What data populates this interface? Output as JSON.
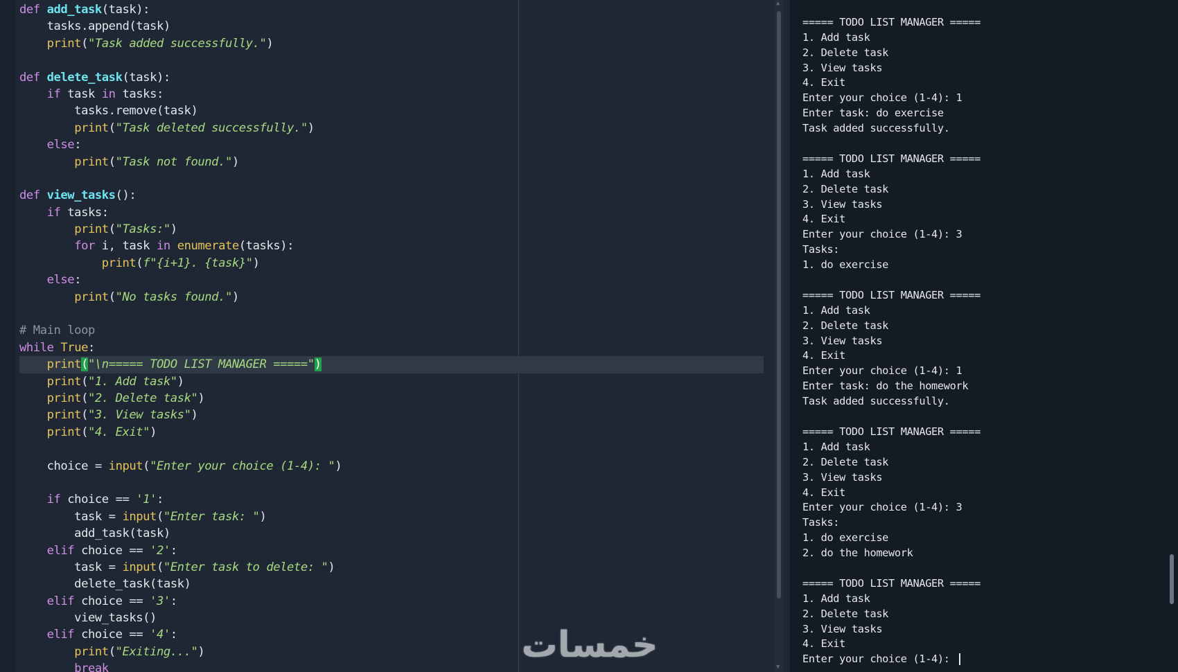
{
  "editor": {
    "lines": [
      [
        [
          "kw",
          "def "
        ],
        [
          "fn",
          "add_task"
        ],
        [
          "pu",
          "(task):"
        ]
      ],
      [
        [
          "pu",
          "    tasks.append(task)"
        ]
      ],
      [
        [
          "pu",
          "    "
        ],
        [
          "bi",
          "print"
        ],
        [
          "pu",
          "("
        ],
        [
          "st",
          "\"Task added successfully.\""
        ],
        [
          "pu",
          ")"
        ]
      ],
      [],
      [
        [
          "kw",
          "def "
        ],
        [
          "fn",
          "delete_task"
        ],
        [
          "pu",
          "(task):"
        ]
      ],
      [
        [
          "pu",
          "    "
        ],
        [
          "kw",
          "if"
        ],
        [
          "pu",
          " task "
        ],
        [
          "kw",
          "in"
        ],
        [
          "pu",
          " tasks:"
        ]
      ],
      [
        [
          "pu",
          "        tasks.remove(task)"
        ]
      ],
      [
        [
          "pu",
          "        "
        ],
        [
          "bi",
          "print"
        ],
        [
          "pu",
          "("
        ],
        [
          "st",
          "\"Task deleted successfully.\""
        ],
        [
          "pu",
          ")"
        ]
      ],
      [
        [
          "pu",
          "    "
        ],
        [
          "kw",
          "else"
        ],
        [
          "pu",
          ":"
        ]
      ],
      [
        [
          "pu",
          "        "
        ],
        [
          "bi",
          "print"
        ],
        [
          "pu",
          "("
        ],
        [
          "st",
          "\"Task not found.\""
        ],
        [
          "pu",
          ")"
        ]
      ],
      [],
      [
        [
          "kw",
          "def "
        ],
        [
          "fn",
          "view_tasks"
        ],
        [
          "pu",
          "():"
        ]
      ],
      [
        [
          "pu",
          "    "
        ],
        [
          "kw",
          "if"
        ],
        [
          "pu",
          " tasks:"
        ]
      ],
      [
        [
          "pu",
          "        "
        ],
        [
          "bi",
          "print"
        ],
        [
          "pu",
          "("
        ],
        [
          "st",
          "\"Tasks:\""
        ],
        [
          "pu",
          ")"
        ]
      ],
      [
        [
          "pu",
          "        "
        ],
        [
          "kw",
          "for"
        ],
        [
          "pu",
          " i, task "
        ],
        [
          "kw",
          "in"
        ],
        [
          "pu",
          " "
        ],
        [
          "bi",
          "enumerate"
        ],
        [
          "pu",
          "(tasks):"
        ]
      ],
      [
        [
          "pu",
          "            "
        ],
        [
          "bi",
          "print"
        ],
        [
          "pu",
          "("
        ],
        [
          "st",
          "f\"{i+1}. {task}\""
        ],
        [
          "pu",
          ")"
        ]
      ],
      [
        [
          "pu",
          "    "
        ],
        [
          "kw",
          "else"
        ],
        [
          "pu",
          ":"
        ]
      ],
      [
        [
          "pu",
          "        "
        ],
        [
          "bi",
          "print"
        ],
        [
          "pu",
          "("
        ],
        [
          "st",
          "\"No tasks found.\""
        ],
        [
          "pu",
          ")"
        ]
      ],
      [],
      [
        [
          "cm",
          "# Main loop"
        ]
      ],
      [
        [
          "kw",
          "while"
        ],
        [
          "pu",
          " "
        ],
        [
          "bi",
          "True"
        ],
        [
          "pu",
          ":"
        ]
      ],
      [
        [
          "pu",
          "    "
        ],
        [
          "bi",
          "print"
        ],
        [
          "bm",
          "("
        ],
        [
          "st",
          "\"\\n===== TODO LIST MANAGER =====\""
        ],
        [
          "bm",
          ")"
        ]
      ],
      [
        [
          "pu",
          "    "
        ],
        [
          "bi",
          "print"
        ],
        [
          "pu",
          "("
        ],
        [
          "st",
          "\"1. Add task\""
        ],
        [
          "pu",
          ")"
        ]
      ],
      [
        [
          "pu",
          "    "
        ],
        [
          "bi",
          "print"
        ],
        [
          "pu",
          "("
        ],
        [
          "st",
          "\"2. Delete task\""
        ],
        [
          "pu",
          ")"
        ]
      ],
      [
        [
          "pu",
          "    "
        ],
        [
          "bi",
          "print"
        ],
        [
          "pu",
          "("
        ],
        [
          "st",
          "\"3. View tasks\""
        ],
        [
          "pu",
          ")"
        ]
      ],
      [
        [
          "pu",
          "    "
        ],
        [
          "bi",
          "print"
        ],
        [
          "pu",
          "("
        ],
        [
          "st",
          "\"4. Exit\""
        ],
        [
          "pu",
          ")"
        ]
      ],
      [],
      [
        [
          "pu",
          "    choice = "
        ],
        [
          "bi",
          "input"
        ],
        [
          "pu",
          "("
        ],
        [
          "st",
          "\"Enter your choice (1-4): \""
        ],
        [
          "pu",
          ")"
        ]
      ],
      [],
      [
        [
          "pu",
          "    "
        ],
        [
          "kw",
          "if"
        ],
        [
          "pu",
          " choice == "
        ],
        [
          "st",
          "'1'"
        ],
        [
          "pu",
          ":"
        ]
      ],
      [
        [
          "pu",
          "        task = "
        ],
        [
          "bi",
          "input"
        ],
        [
          "pu",
          "("
        ],
        [
          "st",
          "\"Enter task: \""
        ],
        [
          "pu",
          ")"
        ]
      ],
      [
        [
          "pu",
          "        add_task(task)"
        ]
      ],
      [
        [
          "pu",
          "    "
        ],
        [
          "kw",
          "elif"
        ],
        [
          "pu",
          " choice == "
        ],
        [
          "st",
          "'2'"
        ],
        [
          "pu",
          ":"
        ]
      ],
      [
        [
          "pu",
          "        task = "
        ],
        [
          "bi",
          "input"
        ],
        [
          "pu",
          "("
        ],
        [
          "st",
          "\"Enter task to delete: \""
        ],
        [
          "pu",
          ")"
        ]
      ],
      [
        [
          "pu",
          "        delete_task(task)"
        ]
      ],
      [
        [
          "pu",
          "    "
        ],
        [
          "kw",
          "elif"
        ],
        [
          "pu",
          " choice == "
        ],
        [
          "st",
          "'3'"
        ],
        [
          "pu",
          ":"
        ]
      ],
      [
        [
          "pu",
          "        view_tasks()"
        ]
      ],
      [
        [
          "pu",
          "    "
        ],
        [
          "kw",
          "elif"
        ],
        [
          "pu",
          " choice == "
        ],
        [
          "st",
          "'4'"
        ],
        [
          "pu",
          ":"
        ]
      ],
      [
        [
          "pu",
          "        "
        ],
        [
          "bi",
          "print"
        ],
        [
          "pu",
          "("
        ],
        [
          "st",
          "\"Exiting...\""
        ],
        [
          "pu",
          ")"
        ]
      ],
      [
        [
          "pu",
          "        "
        ],
        [
          "kw",
          "break"
        ]
      ]
    ],
    "current_line_index": 21,
    "colors": {
      "keyword": "#d08ee6",
      "function_name": "#6ee2ef",
      "builtin": "#e6c35c",
      "string": "#a8d981",
      "comment": "#8b94a3",
      "bracket_match": "#1fa14a"
    }
  },
  "terminal": {
    "lines": [
      "",
      "===== TODO LIST MANAGER =====",
      "1. Add task",
      "2. Delete task",
      "3. View tasks",
      "4. Exit",
      "Enter your choice (1-4): 1",
      "Enter task: do exercise",
      "Task added successfully.",
      "",
      "===== TODO LIST MANAGER =====",
      "1. Add task",
      "2. Delete task",
      "3. View tasks",
      "4. Exit",
      "Enter your choice (1-4): 3",
      "Tasks:",
      "1. do exercise",
      "",
      "===== TODO LIST MANAGER =====",
      "1. Add task",
      "2. Delete task",
      "3. View tasks",
      "4. Exit",
      "Enter your choice (1-4): 1",
      "Enter task: do the homework",
      "Task added successfully.",
      "",
      "===== TODO LIST MANAGER =====",
      "1. Add task",
      "2. Delete task",
      "3. View tasks",
      "4. Exit",
      "Enter your choice (1-4): 3",
      "Tasks:",
      "1. do exercise",
      "2. do the homework",
      "",
      "===== TODO LIST MANAGER =====",
      "1. Add task",
      "2. Delete task",
      "3. View tasks",
      "4. Exit"
    ],
    "prompt_line": "Enter your choice (1-4): "
  },
  "watermark": {
    "text": "خمسات"
  }
}
